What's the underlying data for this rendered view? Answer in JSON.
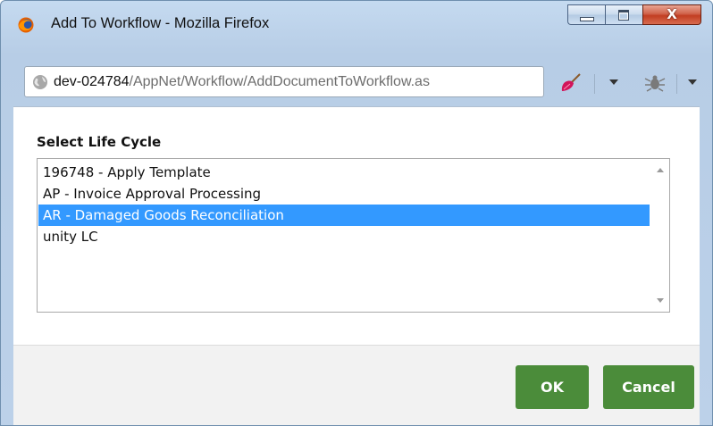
{
  "window": {
    "title": "Add To Workflow - Mozilla Firefox",
    "controls": {
      "minimize": "minimize",
      "maximize": "maximize",
      "close_glyph": "X"
    }
  },
  "urlbar": {
    "host": "dev-024784",
    "path": "/AppNet/Workflow/AddDocumentToWorkflow.as"
  },
  "toolbar": {
    "icons": [
      "globe-icon",
      "broom-icon",
      "chevron-down-icon",
      "bug-icon",
      "chevron-down-icon"
    ]
  },
  "dialog": {
    "section_label": "Select Life Cycle",
    "life_cycles": [
      {
        "label": "196748 - Apply Template",
        "selected": false
      },
      {
        "label": "AP - Invoice Approval Processing",
        "selected": false
      },
      {
        "label": "AR - Damaged Goods Reconciliation",
        "selected": true
      },
      {
        "label": "unity LC",
        "selected": false
      }
    ],
    "ok_label": "OK",
    "cancel_label": "Cancel"
  },
  "colors": {
    "button_green": "#4b8c3a",
    "selection_blue": "#3399ff",
    "titlebar_blue": "#c5daf0",
    "close_red": "#c23e22"
  }
}
